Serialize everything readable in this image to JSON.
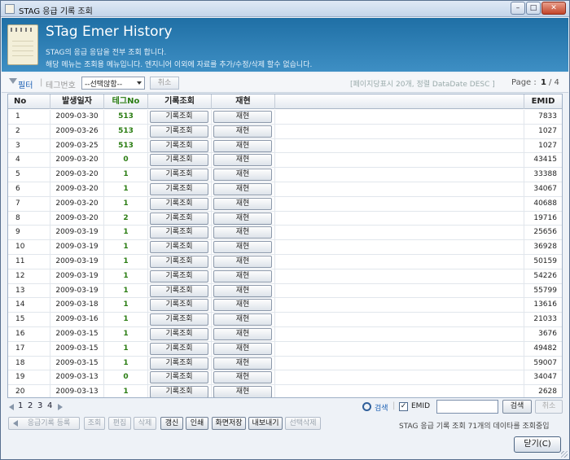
{
  "window": {
    "title": "STAG 응급 기록 조회",
    "min_glyph": "–",
    "max_glyph": "□",
    "close_glyph": "✕"
  },
  "banner": {
    "headline": "STag Emer History",
    "desc1": "STAG의 응급 응답을 전부 조회 합니다.",
    "desc2": "해당 메뉴는 조회용 메뉴입니다. 엔지니어 이외에 자료를 추가/수정/삭제 할수 없습니다."
  },
  "filter": {
    "filter_label": "필터",
    "separator": "|",
    "tag_label": "테그번호",
    "select_value": "--선택않함--",
    "cancel_label": "취소",
    "page_info": "[페이지당표시 20개, 정렬 DataDate DESC ]",
    "page_label": "Page :",
    "page_current": "1",
    "page_total": "/ 4"
  },
  "grid": {
    "headers": {
      "no": "No",
      "date": "발생일자",
      "tag": "테그No",
      "record": "기록조회",
      "replay": "재현",
      "emid": "EMID"
    },
    "record_button_label": "기록조회",
    "replay_button_label": "재현",
    "rows": [
      {
        "no": "1",
        "date": "2009-03-30",
        "tag": "513",
        "emid": "7833"
      },
      {
        "no": "2",
        "date": "2009-03-26",
        "tag": "513",
        "emid": "1027"
      },
      {
        "no": "3",
        "date": "2009-03-25",
        "tag": "513",
        "emid": "1027"
      },
      {
        "no": "4",
        "date": "2009-03-20",
        "tag": "0",
        "emid": "43415"
      },
      {
        "no": "5",
        "date": "2009-03-20",
        "tag": "1",
        "emid": "33388"
      },
      {
        "no": "6",
        "date": "2009-03-20",
        "tag": "1",
        "emid": "34067"
      },
      {
        "no": "7",
        "date": "2009-03-20",
        "tag": "1",
        "emid": "40688"
      },
      {
        "no": "8",
        "date": "2009-03-20",
        "tag": "2",
        "emid": "19716"
      },
      {
        "no": "9",
        "date": "2009-03-19",
        "tag": "1",
        "emid": "25656"
      },
      {
        "no": "10",
        "date": "2009-03-19",
        "tag": "1",
        "emid": "36928"
      },
      {
        "no": "11",
        "date": "2009-03-19",
        "tag": "1",
        "emid": "50159"
      },
      {
        "no": "12",
        "date": "2009-03-19",
        "tag": "1",
        "emid": "54226"
      },
      {
        "no": "13",
        "date": "2009-03-19",
        "tag": "1",
        "emid": "55799"
      },
      {
        "no": "14",
        "date": "2009-03-18",
        "tag": "1",
        "emid": "13616"
      },
      {
        "no": "15",
        "date": "2009-03-16",
        "tag": "1",
        "emid": "21033"
      },
      {
        "no": "16",
        "date": "2009-03-15",
        "tag": "1",
        "emid": "3676"
      },
      {
        "no": "17",
        "date": "2009-03-15",
        "tag": "1",
        "emid": "49482"
      },
      {
        "no": "18",
        "date": "2009-03-15",
        "tag": "1",
        "emid": "59007"
      },
      {
        "no": "19",
        "date": "2009-03-13",
        "tag": "0",
        "emid": "34047"
      },
      {
        "no": "20",
        "date": "2009-03-13",
        "tag": "1",
        "emid": "2628"
      }
    ]
  },
  "pager": {
    "pages": [
      "1",
      "2",
      "3",
      "4"
    ]
  },
  "search": {
    "search_label": "검색",
    "separator": "|",
    "emid_checked_glyph": "✓",
    "emid_label": "EMID",
    "input_value": "",
    "button_label": "검색",
    "cancel_label": "취소"
  },
  "actions": {
    "register": "응급기록 등록",
    "view": "조회",
    "edit": "편집",
    "delete": "삭제",
    "refresh": "갱신",
    "print": "인쇄",
    "save_screen": "화면저장",
    "export": "내보내기",
    "delete_selected": "선택삭제",
    "status": "STAG 응급 기록 조회 71개의 데이타를 조회중입"
  },
  "footer": {
    "close_label": "닫기(C)"
  }
}
